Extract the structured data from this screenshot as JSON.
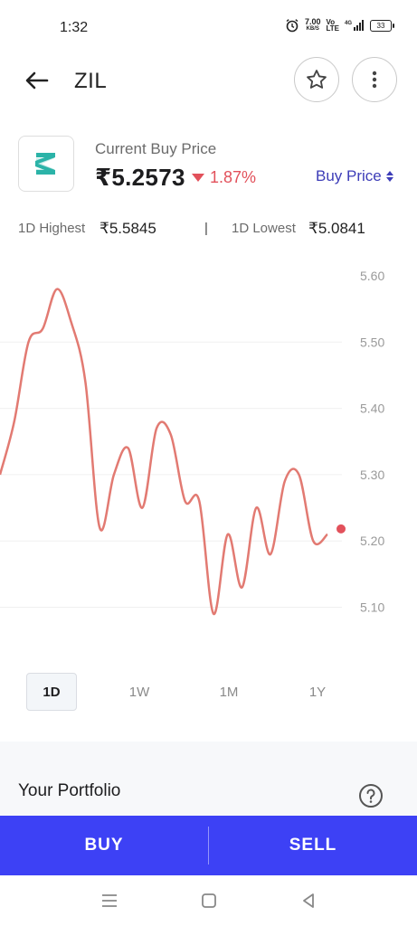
{
  "status_bar": {
    "time": "1:32",
    "net_speed": "7.00",
    "net_unit": "KB/S",
    "volte_top": "Vo",
    "volte_bottom": "LTE",
    "network": "4G",
    "battery": "33",
    "icons": [
      "alarm-icon",
      "signal-icon",
      "battery-icon"
    ]
  },
  "header": {
    "title": "ZIL",
    "back_icon": "arrow-left-icon",
    "favorite_icon": "star-icon",
    "more_icon": "vertical-dots-icon"
  },
  "price": {
    "label": "Current Buy Price",
    "value": "₹5.2573",
    "change": "1.87%",
    "direction": "down",
    "toggle_label": "Buy Price",
    "colors": {
      "down": "#e2515b",
      "accent": "#3d3db8",
      "logo": "#2bb3a8"
    }
  },
  "range": {
    "high_label": "1D Highest",
    "high_value": "₹5.5845",
    "separator": "|",
    "low_label": "1D Lowest",
    "low_value": "₹5.0841"
  },
  "chart_data": {
    "type": "line",
    "y_ticks": [
      "5.60",
      "5.50",
      "5.40",
      "5.30",
      "5.20",
      "5.10"
    ],
    "ylim": [
      5.05,
      5.62
    ],
    "grid": true,
    "line_color": "#e27a72",
    "series": [
      {
        "values": [
          5.3,
          5.38,
          5.5,
          5.52,
          5.58,
          5.53,
          5.44,
          5.22,
          5.3,
          5.34,
          5.25,
          5.37,
          5.36,
          5.26,
          5.26,
          5.09,
          5.21,
          5.13,
          5.25,
          5.18,
          5.29,
          5.3,
          5.2,
          5.21
        ],
        "last_point": 5.21
      }
    ]
  },
  "tabs": [
    {
      "label": "1D",
      "active": true
    },
    {
      "label": "1W",
      "active": false
    },
    {
      "label": "1M",
      "active": false
    },
    {
      "label": "1Y",
      "active": false
    }
  ],
  "portfolio": {
    "title": "Your Portfolio",
    "help_icon": "question-circle-icon"
  },
  "actions": {
    "buy_label": "BUY",
    "sell_label": "SELL",
    "color": "#3d41f5"
  },
  "nav": {
    "icons": [
      "menu-icon",
      "home-square-icon",
      "back-triangle-icon"
    ]
  }
}
